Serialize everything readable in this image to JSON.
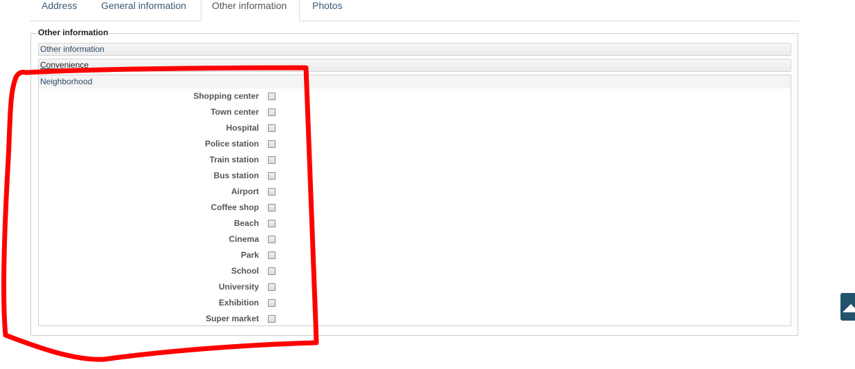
{
  "tabs": [
    {
      "label": "Address"
    },
    {
      "label": "General information"
    },
    {
      "label": "Other information"
    },
    {
      "label": "Photos"
    }
  ],
  "fieldset": {
    "legend": "Other information"
  },
  "accordion": {
    "other_information": "Other information",
    "convenience": "Convenience",
    "neighborhood": "Neighborhood"
  },
  "neighborhood_options": [
    {
      "label": "Shopping center",
      "checked": false
    },
    {
      "label": "Town center",
      "checked": false
    },
    {
      "label": "Hospital",
      "checked": false
    },
    {
      "label": "Police station",
      "checked": false
    },
    {
      "label": "Train station",
      "checked": false
    },
    {
      "label": "Bus station",
      "checked": false
    },
    {
      "label": "Airport",
      "checked": false
    },
    {
      "label": "Coffee shop",
      "checked": false
    },
    {
      "label": "Beach",
      "checked": false
    },
    {
      "label": "Cinema",
      "checked": false
    },
    {
      "label": "Park",
      "checked": false
    },
    {
      "label": "School",
      "checked": false
    },
    {
      "label": "University",
      "checked": false
    },
    {
      "label": "Exhibition",
      "checked": false
    },
    {
      "label": "Super market",
      "checked": false
    }
  ],
  "colors": {
    "annotation": "#ff0000",
    "scroll_button": "#23526d"
  },
  "icons": {
    "scroll_top": "arrow-up-icon"
  }
}
